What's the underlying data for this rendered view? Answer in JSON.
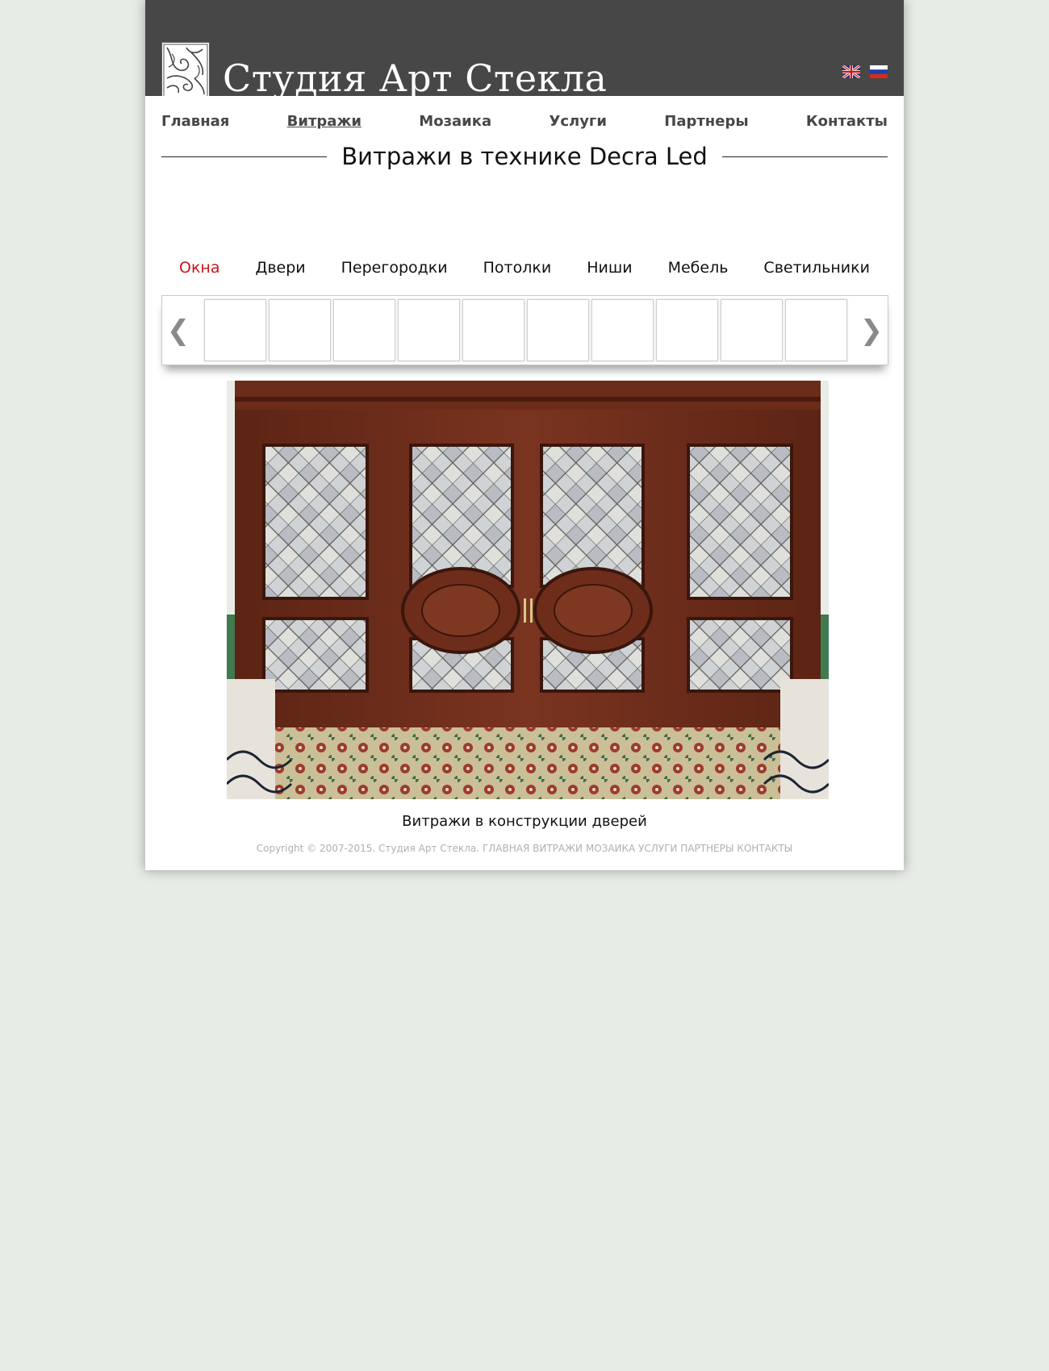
{
  "brand": {
    "name": "Студия Арт Стекла",
    "logo_icon": "stained-glass-logo-icon"
  },
  "languages": [
    {
      "code": "en",
      "icon": "uk-flag-icon"
    },
    {
      "code": "ru",
      "icon": "russia-flag-icon"
    }
  ],
  "nav": {
    "items": [
      {
        "label": "Главная"
      },
      {
        "label": "Витражи",
        "active": true
      },
      {
        "label": "Мозаика"
      },
      {
        "label": "Услуги"
      },
      {
        "label": "Партнеры"
      },
      {
        "label": "Контакты"
      }
    ]
  },
  "page_title": "Витражи в технике Decra Led",
  "categories": [
    {
      "label": "Окна",
      "active": true
    },
    {
      "label": "Двери"
    },
    {
      "label": "Перегородки"
    },
    {
      "label": "Потолки"
    },
    {
      "label": "Ниши"
    },
    {
      "label": "Мебель"
    },
    {
      "label": "Светильники"
    }
  ],
  "carousel": {
    "prev_label": "❮",
    "next_label": "❯",
    "thumb_count": 10
  },
  "caption": "Витражи в конструкции дверей",
  "footer": {
    "copyright": "Copyright © 2007-2015. Студия Арт Стекла.",
    "links": [
      "ГЛАВНАЯ",
      "ВИТРАЖИ",
      "МОЗАИКА",
      "УСЛУГИ",
      "ПАРТНЕРЫ",
      "КОНТАКТЫ"
    ]
  },
  "colors": {
    "header_bg": "#474747",
    "page_bg": "#e8ece6",
    "active_category": "#c8161d"
  }
}
